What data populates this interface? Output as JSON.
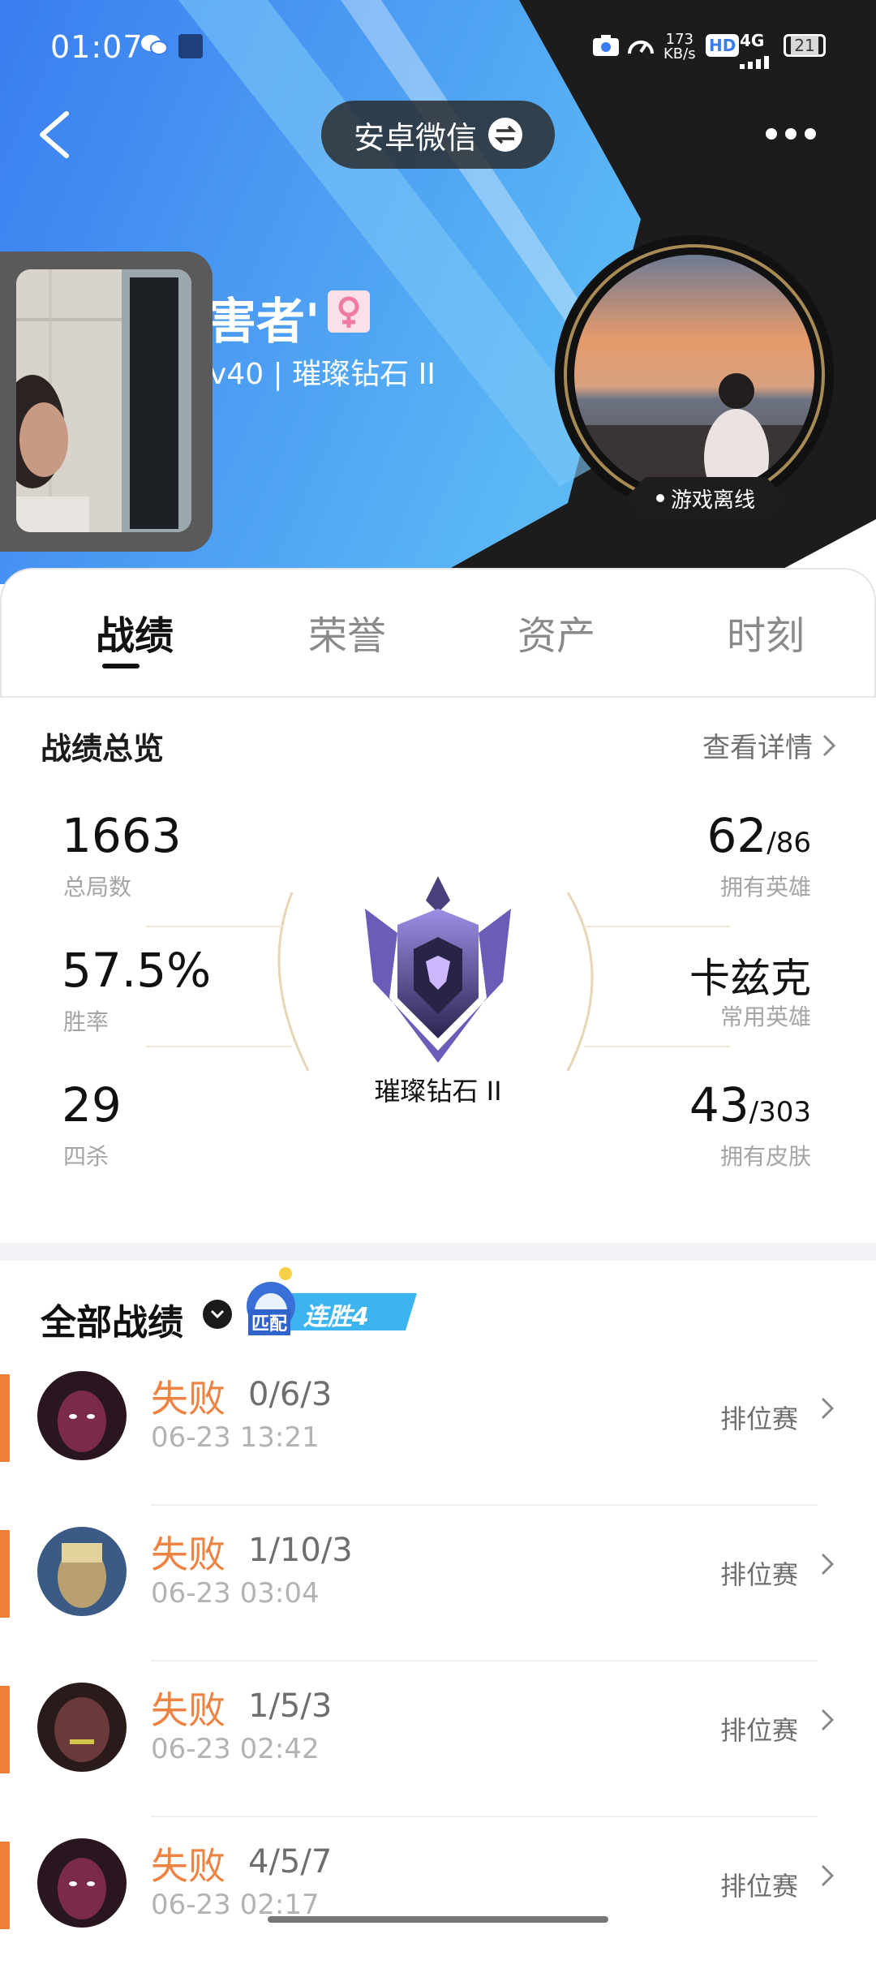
{
  "status_bar": {
    "time": "01:07",
    "net_speed": "173\nKB/s",
    "net_speed_top": "173",
    "net_speed_unit": "KB/s",
    "hd": "HD",
    "signal": "4G",
    "battery": "21"
  },
  "topbar": {
    "account_switch_label": "安卓微信"
  },
  "profile": {
    "name_visible": "害者'",
    "subtitle": "v40 | 璀璨钻石 II",
    "status": "游戏离线"
  },
  "tabs": [
    {
      "label": "战绩",
      "active": true
    },
    {
      "label": "荣誉",
      "active": false
    },
    {
      "label": "资产",
      "active": false
    },
    {
      "label": "时刻",
      "active": false
    }
  ],
  "overview": {
    "title": "战绩总览",
    "detail_link": "查看详情",
    "total_games": {
      "value": "1663",
      "label": "总局数"
    },
    "win_rate": {
      "value": "57.5%",
      "label": "胜率"
    },
    "quadra_kills": {
      "value": "29",
      "label": "四杀"
    },
    "heroes_owned": {
      "value": "62",
      "total": "/86",
      "label": "拥有英雄"
    },
    "common_hero": {
      "value": "卡兹克",
      "label": "常用英雄"
    },
    "skins_owned": {
      "value": "43",
      "total": "/303",
      "label": "拥有皮肤"
    },
    "rank": "璀璨钻石 II"
  },
  "matches_section": {
    "title": "全部战绩",
    "badge_mode": "匹配",
    "badge_streak": "连胜4"
  },
  "matches": [
    {
      "result": "失败",
      "kda": "0/6/3",
      "date": "06-23 13:21",
      "mode": "排位赛",
      "hero_color": "#7a2a4a"
    },
    {
      "result": "失败",
      "kda": "1/10/3",
      "date": "06-23 03:04",
      "mode": "排位赛",
      "hero_color": "#b8a070"
    },
    {
      "result": "失败",
      "kda": "1/5/3",
      "date": "06-23 02:42",
      "mode": "排位赛",
      "hero_color": "#6a3a3a"
    },
    {
      "result": "失败",
      "kda": "4/5/7",
      "date": "06-23 02:17",
      "mode": "排位赛",
      "hero_color": "#7a2a4a"
    }
  ],
  "colors": {
    "header_blue": "#3f8ef2",
    "loss_orange": "#ef8240",
    "accent_bar": "#f07f3a"
  }
}
